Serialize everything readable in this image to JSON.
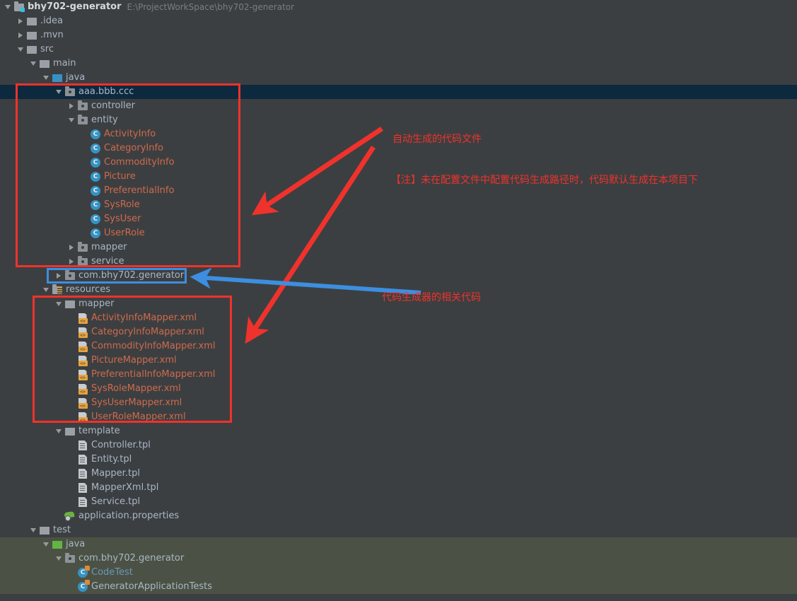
{
  "window": {
    "project_name": "bhy702-generator",
    "project_path": "E:\\ProjectWorkSpace\\bhy702-generator"
  },
  "tree": [
    {
      "label": "bhy702-generator",
      "path": "E:\\ProjectWorkSpace\\bhy702-generator",
      "icon": "module-icon",
      "arrow": "down",
      "depth": 0,
      "style": "bold"
    },
    {
      "label": ".idea",
      "icon": "folder-grey-icon",
      "arrow": "right",
      "depth": 1,
      "style": "grey"
    },
    {
      "label": ".mvn",
      "icon": "folder-grey-icon",
      "arrow": "right",
      "depth": 1,
      "style": "grey"
    },
    {
      "label": "src",
      "icon": "folder-grey-icon",
      "arrow": "down",
      "depth": 1,
      "style": "grey"
    },
    {
      "label": "main",
      "icon": "folder-grey-icon",
      "arrow": "down",
      "depth": 2,
      "style": "grey"
    },
    {
      "label": "java",
      "icon": "folder-blue-icon",
      "arrow": "down",
      "depth": 3,
      "style": "grey"
    },
    {
      "label": "aaa.bbb.ccc",
      "icon": "package-icon",
      "arrow": "down",
      "depth": 4,
      "style": "grey",
      "selected": true
    },
    {
      "label": "controller",
      "icon": "package-icon",
      "arrow": "right",
      "depth": 5,
      "style": "grey"
    },
    {
      "label": "entity",
      "icon": "package-icon",
      "arrow": "down",
      "depth": 5,
      "style": "grey"
    },
    {
      "label": "ActivityInfo",
      "icon": "java-class-icon",
      "arrow": "none",
      "depth": 6,
      "style": "red"
    },
    {
      "label": "CategoryInfo",
      "icon": "java-class-icon",
      "arrow": "none",
      "depth": 6,
      "style": "red"
    },
    {
      "label": "CommodityInfo",
      "icon": "java-class-icon",
      "arrow": "none",
      "depth": 6,
      "style": "red"
    },
    {
      "label": "Picture",
      "icon": "java-class-icon",
      "arrow": "none",
      "depth": 6,
      "style": "red"
    },
    {
      "label": "PreferentialInfo",
      "icon": "java-class-icon",
      "arrow": "none",
      "depth": 6,
      "style": "red"
    },
    {
      "label": "SysRole",
      "icon": "java-class-icon",
      "arrow": "none",
      "depth": 6,
      "style": "red"
    },
    {
      "label": "SysUser",
      "icon": "java-class-icon",
      "arrow": "none",
      "depth": 6,
      "style": "red"
    },
    {
      "label": "UserRole",
      "icon": "java-class-icon",
      "arrow": "none",
      "depth": 6,
      "style": "red"
    },
    {
      "label": "mapper",
      "icon": "package-icon",
      "arrow": "right",
      "depth": 5,
      "style": "grey"
    },
    {
      "label": "service",
      "icon": "package-icon",
      "arrow": "right",
      "depth": 5,
      "style": "grey"
    },
    {
      "label": "com.bhy702.generator",
      "icon": "package-icon",
      "arrow": "right",
      "depth": 4,
      "style": "grey"
    },
    {
      "label": "resources",
      "icon": "resources-folder-icon",
      "arrow": "down",
      "depth": 3,
      "style": "grey"
    },
    {
      "label": "mapper",
      "icon": "folder-grey-icon",
      "arrow": "down",
      "depth": 4,
      "style": "grey"
    },
    {
      "label": "ActivityInfoMapper.xml",
      "icon": "xml-file-icon",
      "arrow": "none",
      "depth": 5,
      "style": "red"
    },
    {
      "label": "CategoryInfoMapper.xml",
      "icon": "xml-file-icon",
      "arrow": "none",
      "depth": 5,
      "style": "red"
    },
    {
      "label": "CommodityInfoMapper.xml",
      "icon": "xml-file-icon",
      "arrow": "none",
      "depth": 5,
      "style": "red"
    },
    {
      "label": "PictureMapper.xml",
      "icon": "xml-file-icon",
      "arrow": "none",
      "depth": 5,
      "style": "red"
    },
    {
      "label": "PreferentialInfoMapper.xml",
      "icon": "xml-file-icon",
      "arrow": "none",
      "depth": 5,
      "style": "red"
    },
    {
      "label": "SysRoleMapper.xml",
      "icon": "xml-file-icon",
      "arrow": "none",
      "depth": 5,
      "style": "red"
    },
    {
      "label": "SysUserMapper.xml",
      "icon": "xml-file-icon",
      "arrow": "none",
      "depth": 5,
      "style": "red"
    },
    {
      "label": "UserRoleMapper.xml",
      "icon": "xml-file-icon",
      "arrow": "none",
      "depth": 5,
      "style": "red"
    },
    {
      "label": "template",
      "icon": "folder-grey-icon",
      "arrow": "down",
      "depth": 4,
      "style": "grey"
    },
    {
      "label": "Controller.tpl",
      "icon": "file-icon",
      "arrow": "none",
      "depth": 5,
      "style": "grey"
    },
    {
      "label": "Entity.tpl",
      "icon": "file-icon",
      "arrow": "none",
      "depth": 5,
      "style": "grey"
    },
    {
      "label": "Mapper.tpl",
      "icon": "file-icon",
      "arrow": "none",
      "depth": 5,
      "style": "grey"
    },
    {
      "label": "MapperXml.tpl",
      "icon": "file-icon",
      "arrow": "none",
      "depth": 5,
      "style": "grey"
    },
    {
      "label": "Service.tpl",
      "icon": "file-icon",
      "arrow": "none",
      "depth": 5,
      "style": "grey"
    },
    {
      "label": "application.properties",
      "icon": "spring-properties-icon",
      "arrow": "none",
      "depth": 4,
      "style": "grey"
    },
    {
      "label": "test",
      "icon": "folder-grey-icon",
      "arrow": "down",
      "depth": 2,
      "style": "grey"
    },
    {
      "label": "java",
      "icon": "folder-green-icon",
      "arrow": "down",
      "depth": 3,
      "style": "grey",
      "tint": true
    },
    {
      "label": "com.bhy702.generator",
      "icon": "package-icon",
      "arrow": "down",
      "depth": 4,
      "style": "grey",
      "tint": true
    },
    {
      "label": "CodeTest",
      "icon": "java-test-class-icon",
      "arrow": "none",
      "depth": 5,
      "style": "blue",
      "tint": true
    },
    {
      "label": "GeneratorApplicationTests",
      "icon": "java-test-class-icon",
      "arrow": "none",
      "depth": 5,
      "style": "grey",
      "tint": true
    }
  ],
  "annotations": {
    "note_generated_code": "自动生成的代码文件",
    "note_default_path": "【注】未在配置文件中配置代码生成路径时，代码默认生成在本项目下",
    "note_generator_code": "代码生成器的相关代码",
    "colors": {
      "red": "#f0322c",
      "blue": "#3d8ee0"
    }
  }
}
